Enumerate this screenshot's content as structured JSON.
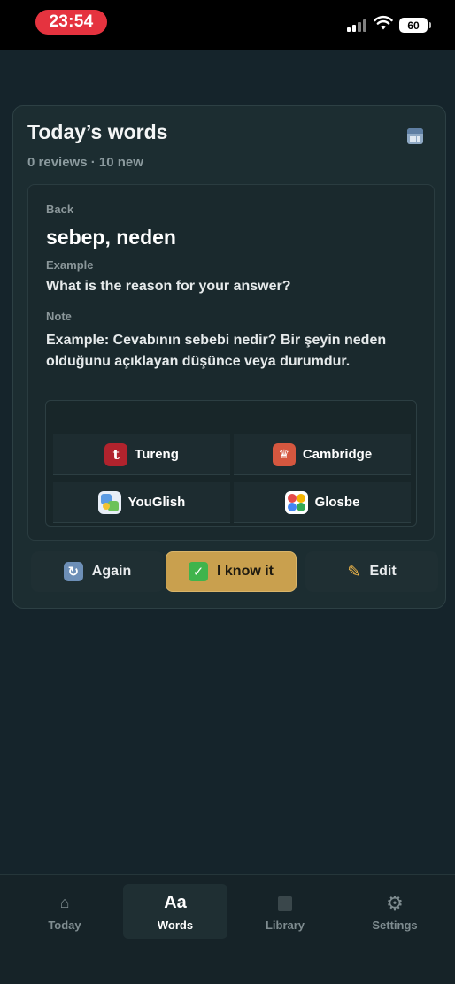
{
  "status_bar": {
    "time": "23:54",
    "battery": "60"
  },
  "card": {
    "title": "Today’s words",
    "subtitle": "0 reviews · 10 new",
    "back_label": "Back",
    "back_text": "sebep, neden",
    "example_label": "Example",
    "example_text": "What is the reason for your answer?",
    "note_label": "Note",
    "note_text": "Example: Cevabının sebebi nedir? Bir şeyin neden olduğunu açıklayan düşünce veya durumdur."
  },
  "links": [
    {
      "label": "Tureng",
      "icon": "tureng-icon"
    },
    {
      "label": "Cambridge",
      "icon": "cambridge-icon"
    },
    {
      "label": "YouGlish",
      "icon": "youglish-icon"
    },
    {
      "label": "Glosbe",
      "icon": "glosbe-icon"
    }
  ],
  "actions": {
    "again": "Again",
    "know": "I know it",
    "edit": "Edit"
  },
  "nav": [
    {
      "label": "Today",
      "icon": "home-icon",
      "active": false
    },
    {
      "label": "Words",
      "icon": "text-aa-icon",
      "icon_text": "Aa",
      "active": true
    },
    {
      "label": "Library",
      "icon": "library-icon",
      "active": false
    },
    {
      "label": "Settings",
      "icon": "gear-icon",
      "active": false
    }
  ],
  "colors": {
    "background": "#15242b",
    "accent": "#c9a04e",
    "status_pill": "#e5333f"
  }
}
